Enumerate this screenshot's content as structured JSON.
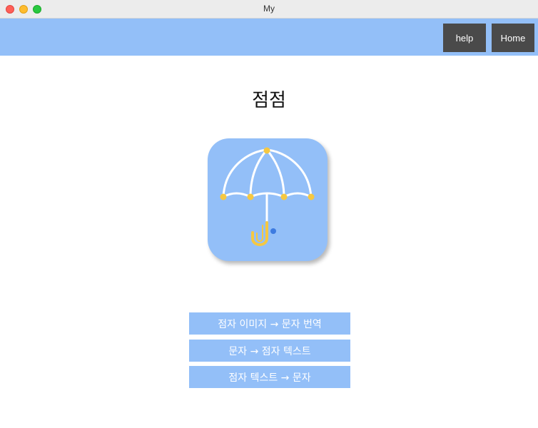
{
  "window": {
    "title": "My"
  },
  "header": {
    "help_label": "help",
    "home_label": "Home",
    "background": "#93bff8"
  },
  "main": {
    "title": "점점",
    "logo_icon": "umbrella-braille-icon",
    "buttons": [
      {
        "label": "점자 이미지 → 문자 번역"
      },
      {
        "label": "문자 → 점자 텍스트"
      },
      {
        "label": "점자 텍스트 → 문자"
      }
    ]
  },
  "colors": {
    "accent": "#93bff8",
    "nav_button": "#4a4a4a",
    "dot_yellow": "#f5c842",
    "dot_blue": "#3d7be0"
  }
}
